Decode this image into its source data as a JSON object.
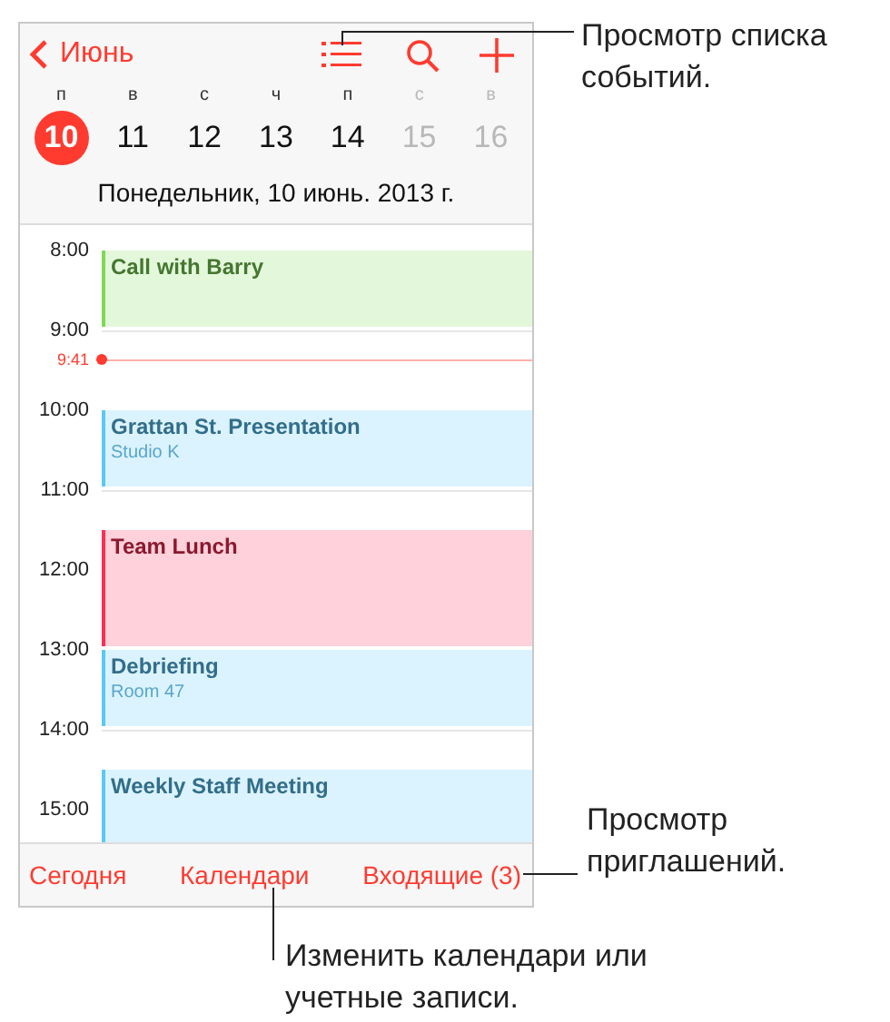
{
  "nav": {
    "back_label": "Июнь"
  },
  "week": [
    {
      "weekday": "п",
      "date": "10",
      "selected": true,
      "dimmed": false
    },
    {
      "weekday": "в",
      "date": "11",
      "selected": false,
      "dimmed": false
    },
    {
      "weekday": "с",
      "date": "12",
      "selected": false,
      "dimmed": false
    },
    {
      "weekday": "ч",
      "date": "13",
      "selected": false,
      "dimmed": false
    },
    {
      "weekday": "п",
      "date": "14",
      "selected": false,
      "dimmed": false
    },
    {
      "weekday": "с",
      "date": "15",
      "selected": false,
      "dimmed": true
    },
    {
      "weekday": "в",
      "date": "16",
      "selected": false,
      "dimmed": true
    }
  ],
  "selected_date": "Понедельник, 10 июнь. 2013 г.",
  "hours": [
    "8:00",
    "9:00",
    "10:00",
    "11:00",
    "12:00",
    "13:00",
    "14:00",
    "15:00"
  ],
  "now": {
    "label": "9:41"
  },
  "events": [
    {
      "title": "Call with Barry",
      "color": "#7ed957"
    },
    {
      "title": "Grattan St. Presentation",
      "location": "Studio K",
      "color": "#5ac8fa"
    },
    {
      "title": "Team Lunch",
      "color": "#ff2d55"
    },
    {
      "title": "Debriefing",
      "location": "Room 47",
      "color": "#5ac8fa"
    },
    {
      "title": "Weekly Staff Meeting",
      "color": "#5ac8fa"
    }
  ],
  "toolbar": [
    "Сегодня",
    "Календари",
    "Входящие (3)"
  ],
  "callouts": {
    "list_view": "Просмотр списка событий.",
    "inbox": "Просмотр приглашений.",
    "calendars": "Изменить календари или учетные записи."
  }
}
